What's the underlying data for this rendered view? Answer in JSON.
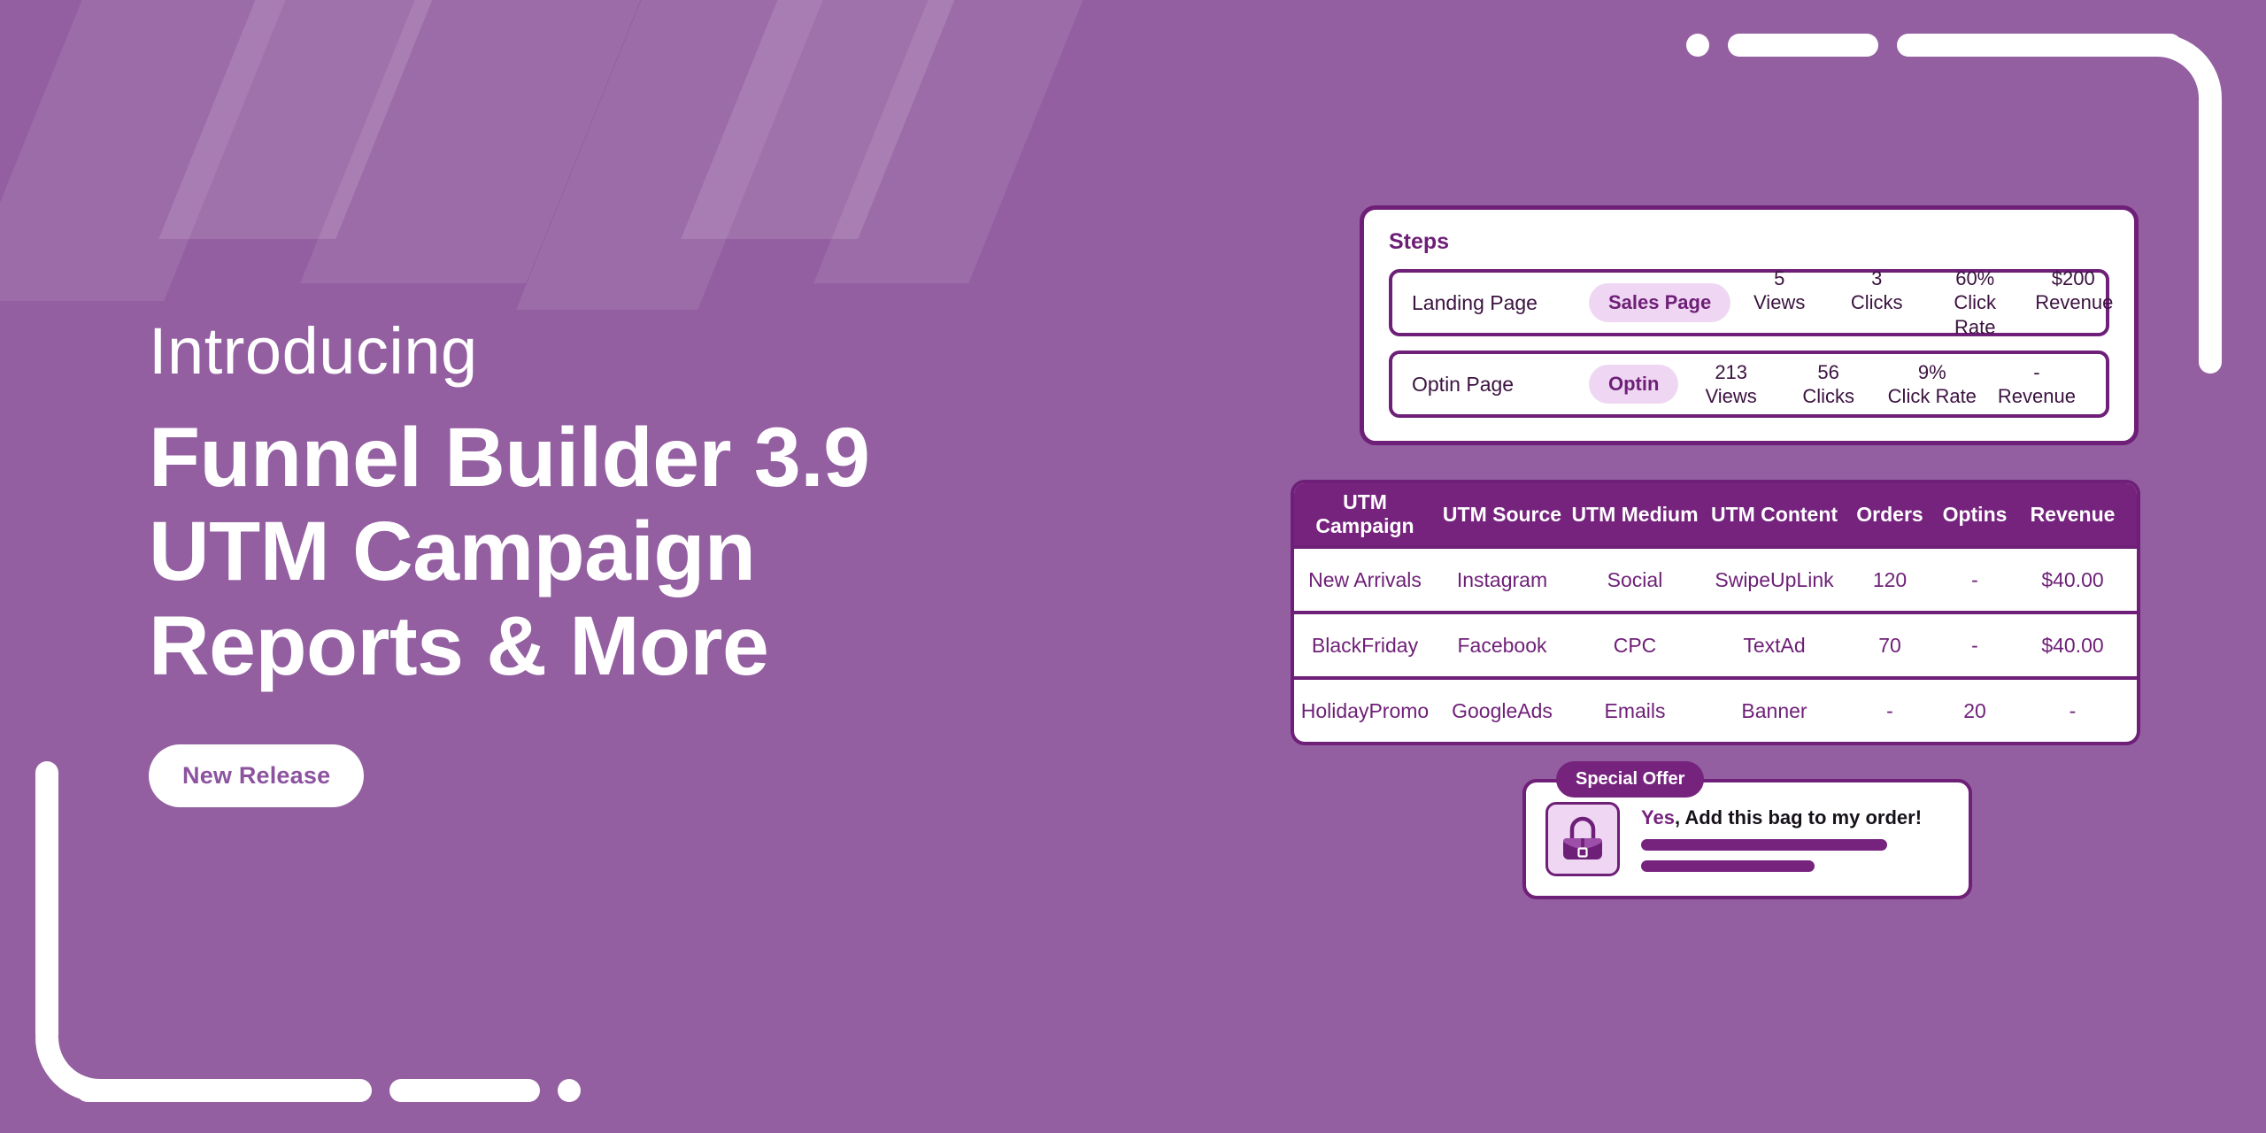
{
  "theme": {
    "background": "#935FA1",
    "deep_purple": "#6E1F77",
    "header_purple": "#76237E",
    "pill_bg": "#EFD7F3",
    "white": "#FFFFFF",
    "badge_text": "#8C54A0"
  },
  "hero": {
    "eyebrow": "Introducing",
    "headline_lines": [
      "Funnel Builder 3.9",
      "UTM Campaign",
      "Reports & More"
    ],
    "badge_label": "New Release"
  },
  "steps_card": {
    "title": "Steps",
    "rows": [
      {
        "name": "Landing Page",
        "pill": "Sales Page",
        "metrics": [
          {
            "value": "5",
            "label": "Views"
          },
          {
            "value": "3",
            "label": "Clicks"
          },
          {
            "value": "60%",
            "label": "Click Rate"
          },
          {
            "value": "$200",
            "label": "Revenue"
          }
        ]
      },
      {
        "name": "Optin Page",
        "pill": "Optin",
        "metrics": [
          {
            "value": "213",
            "label": "Views"
          },
          {
            "value": "56",
            "label": "Clicks"
          },
          {
            "value": "9%",
            "label": "Click Rate"
          },
          {
            "value": "-",
            "label": "Revenue"
          }
        ]
      }
    ]
  },
  "utm_table": {
    "columns": [
      "UTM Campaign",
      "UTM Source",
      "UTM Medium",
      "UTM Content",
      "Orders",
      "Optins",
      "Revenue"
    ],
    "rows": [
      [
        "New Arrivals",
        "Instagram",
        "Social",
        "SwipeUpLink",
        "120",
        "-",
        "$40.00"
      ],
      [
        "BlackFriday",
        "Facebook",
        "CPC",
        "TextAd",
        "70",
        "-",
        "$40.00"
      ],
      [
        "HolidayPromo",
        "GoogleAds",
        "Emails",
        "Banner",
        "-",
        "20",
        "-"
      ]
    ]
  },
  "special_offer": {
    "badge": "Special Offer",
    "headline_accent": "Yes",
    "headline_rest": ", Add this bag to my order!",
    "product_icon": "handbag-icon"
  }
}
